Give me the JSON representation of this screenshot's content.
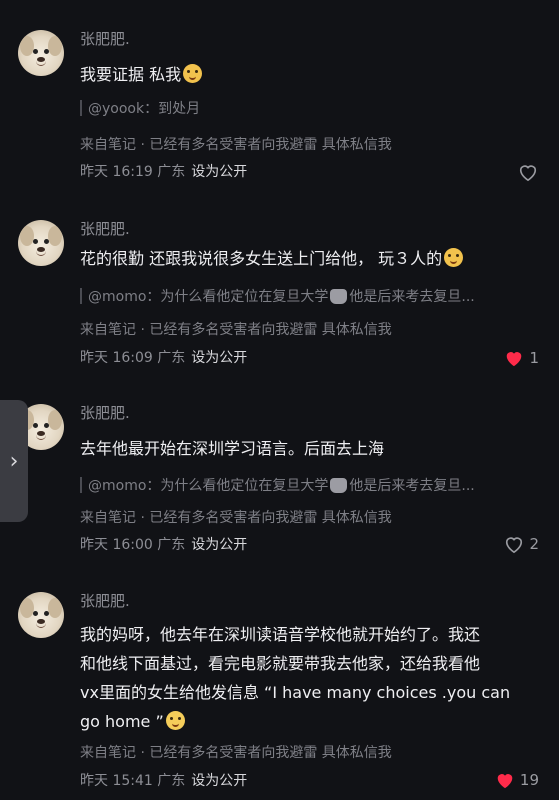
{
  "comments": [
    {
      "name": "张肥肥.",
      "text": "我要证据 私我",
      "emoji": "smile-emoji",
      "quote": "@yoook：到处月",
      "source": "来自笔记 · 已经有多名受害者向我避雷 具体私信我",
      "time": "昨天 16:19 广东",
      "public": "设为公开",
      "likes": "",
      "liked": false
    },
    {
      "name": "张肥肥.",
      "text": "花的很勤 还跟我说很多女生送上门给他， 玩３人的",
      "emoji": "smile-emoji",
      "quote_a": "@momo：为什么看他定位在复旦大学",
      "quote_b": "他是后来考去复旦...",
      "source": "来自笔记 · 已经有多名受害者向我避雷 具体私信我",
      "time": "昨天 16:09 广东",
      "public": "设为公开",
      "likes": "1",
      "liked": true
    },
    {
      "name": "张肥肥.",
      "text": "去年他最开始在深圳学习语言。后面去上海",
      "quote_a": "@momo：为什么看他定位在复旦大学",
      "quote_b": "他是后来考去复旦...",
      "source": "来自笔记 · 已经有多名受害者向我避雷 具体私信我",
      "time": "昨天 16:00 广东",
      "public": "设为公开",
      "likes": "2",
      "liked": false
    },
    {
      "name": "张肥肥.",
      "lines": [
        "我的妈呀，他去年在深圳读语音学校他就开始约了。我还",
        "和他线下面基过，看完电影就要带我去他家，还给我看他",
        "vx里面的女生给他发信息 “I have many choices .you can",
        "go home ”"
      ],
      "emoji": "crying-emoji",
      "source": "来自笔记 · 已经有多名受害者向我避雷 具体私信我",
      "time": "昨天 15:41 广东",
      "public": "设为公开",
      "likes": "19",
      "liked": true
    }
  ],
  "side_tab": {
    "icon": "chevron-right-icon",
    "glyph": "›"
  },
  "colors": {
    "background": "#111216",
    "like_red": "#ff2b4a",
    "meta_gray": "#8d8e95"
  }
}
